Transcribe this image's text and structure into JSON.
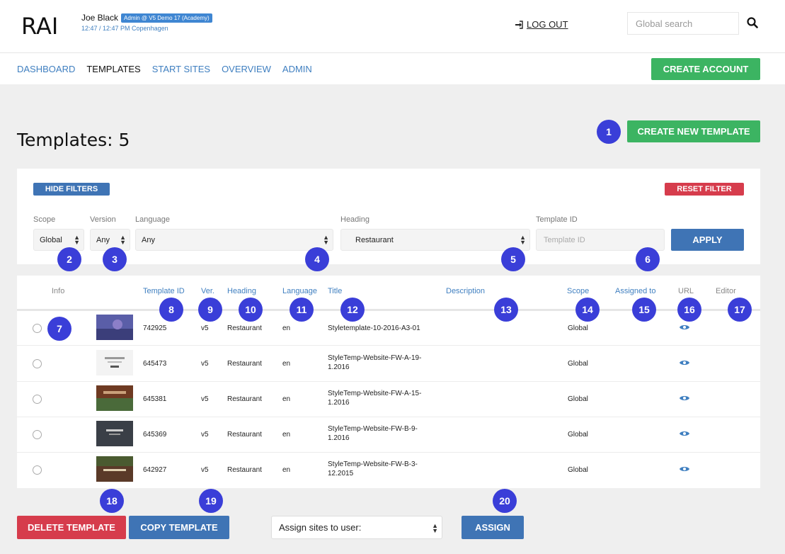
{
  "header": {
    "logo": "RAI",
    "user_name": "Joe Black",
    "user_badge": "Admin @ V5 Demo 17 (Academy)",
    "user_time": "12:47 / 12:47 PM Copenhagen",
    "logout": "LOG OUT",
    "search_placeholder": "Global search"
  },
  "nav": {
    "items": [
      "DASHBOARD",
      "TEMPLATES",
      "START SITES",
      "OVERVIEW",
      "ADMIN"
    ],
    "active": "TEMPLATES",
    "create_account": "CREATE ACCOUNT"
  },
  "page": {
    "title": "Templates: 5",
    "create_template": "CREATE NEW TEMPLATE"
  },
  "filters": {
    "hide": "HIDE FILTERS",
    "reset": "RESET FILTER",
    "scope_label": "Scope",
    "scope_value": "Global",
    "version_label": "Version",
    "version_value": "Any",
    "language_label": "Language",
    "language_value": "Any",
    "heading_label": "Heading",
    "heading_value": "Restaurant",
    "template_id_label": "Template ID",
    "template_id_placeholder": "Template ID",
    "apply": "APPLY"
  },
  "table": {
    "columns": [
      "Info",
      "Template ID",
      "Ver.",
      "Heading",
      "Language",
      "Title",
      "Description",
      "Scope",
      "Assigned to",
      "URL",
      "Editor"
    ],
    "rows": [
      {
        "id": "742925",
        "ver": "v5",
        "heading": "Restaurant",
        "lang": "en",
        "title1": "Styletemplate-10-2016-A3-01",
        "title2": "",
        "scope": "Global"
      },
      {
        "id": "645473",
        "ver": "v5",
        "heading": "Restaurant",
        "lang": "en",
        "title1": "StyleTemp-Website-FW-A-19-",
        "title2": "1.2016",
        "scope": "Global"
      },
      {
        "id": "645381",
        "ver": "v5",
        "heading": "Restaurant",
        "lang": "en",
        "title1": "StyleTemp-Website-FW-A-15-",
        "title2": "1.2016",
        "scope": "Global"
      },
      {
        "id": "645369",
        "ver": "v5",
        "heading": "Restaurant",
        "lang": "en",
        "title1": "StyleTemp-Website-FW-B-9-",
        "title2": "1.2016",
        "scope": "Global"
      },
      {
        "id": "642927",
        "ver": "v5",
        "heading": "Restaurant",
        "lang": "en",
        "title1": "StyleTemp-Website-FW-B-3-",
        "title2": "12.2015",
        "scope": "Global"
      }
    ]
  },
  "actions": {
    "delete": "DELETE TEMPLATE",
    "copy": "COPY TEMPLATE",
    "assign_select": "Assign sites to user:",
    "assign": "ASSIGN"
  },
  "annotations": [
    "1",
    "2",
    "3",
    "4",
    "5",
    "6",
    "7",
    "8",
    "9",
    "10",
    "11",
    "12",
    "13",
    "14",
    "15",
    "16",
    "17",
    "18",
    "19",
    "20"
  ],
  "colors": {
    "accent_green": "#3cb462",
    "accent_blue": "#3f74b5",
    "accent_red": "#d63c4c",
    "annotation": "#3a3ed8"
  }
}
